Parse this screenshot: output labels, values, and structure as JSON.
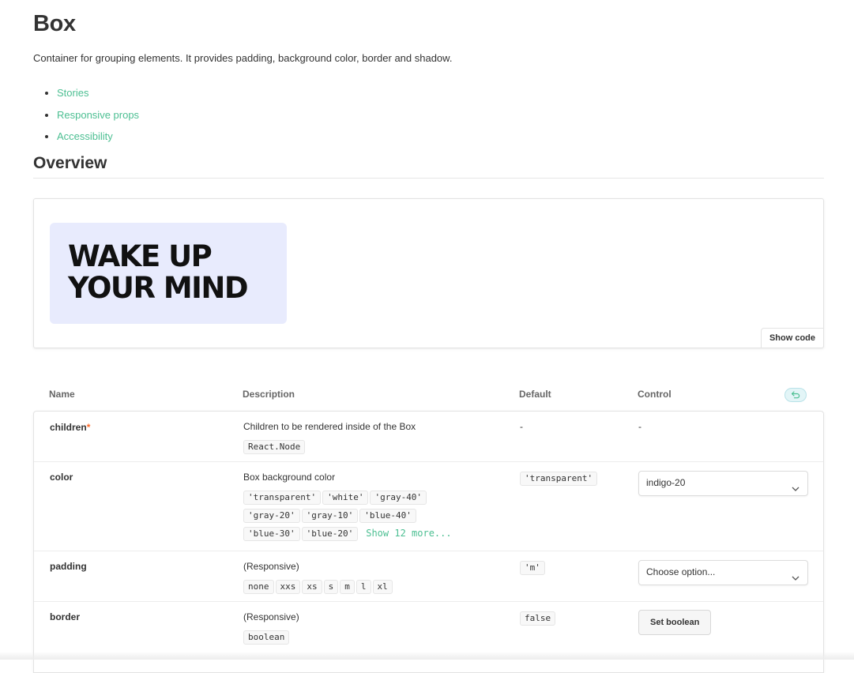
{
  "page": {
    "title": "Box",
    "description": "Container for grouping elements. It provides padding, background color, border and shadow.",
    "toc": [
      "Stories",
      "Responsive props",
      "Accessibility"
    ],
    "overview_heading": "Overview"
  },
  "preview": {
    "text_line1": "WAKE UP",
    "text_line2": "YOUR MIND",
    "show_code_label": "Show code",
    "box_color": "#e8ebfd"
  },
  "props_table": {
    "headers": {
      "name": "Name",
      "description": "Description",
      "default": "Default",
      "control": "Control"
    },
    "rows": [
      {
        "name": "children",
        "required_mark": "*",
        "description": "Children to be rendered inside of the Box",
        "type_chips": [
          "React.Node"
        ],
        "default": "-",
        "control": "-"
      },
      {
        "name": "color",
        "description": "Box background color",
        "type_chips": [
          "'transparent'",
          "'white'",
          "'gray-40'",
          "'gray-20'",
          "'gray-10'",
          "'blue-40'",
          "'blue-30'",
          "'blue-20'"
        ],
        "more_link": "Show 12 more...",
        "default_chip": "'transparent'",
        "control_value": "indigo-20"
      },
      {
        "name": "padding",
        "description": "(Responsive)",
        "type_chips": [
          "none",
          "xxs",
          "xs",
          "s",
          "m",
          "l",
          "xl"
        ],
        "default_chip": "'m'",
        "control_value": "Choose option..."
      },
      {
        "name": "border",
        "description": "(Responsive)",
        "type_chips": [
          "boolean"
        ],
        "default_chip": "false",
        "control_button": "Set boolean"
      }
    ]
  },
  "colors": {
    "link": "#4cbf92",
    "required": "#ff6a28",
    "reset_bg": "#e3f5f7"
  }
}
